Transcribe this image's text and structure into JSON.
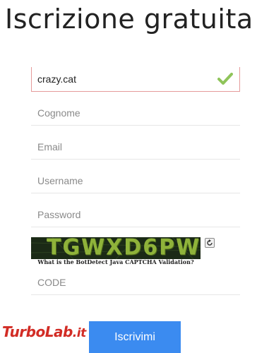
{
  "page": {
    "title": "Iscrizione gratuita"
  },
  "form": {
    "first_name": {
      "value": "crazy.cat",
      "placeholder": ""
    },
    "last_name": {
      "value": "",
      "placeholder": "Cognome"
    },
    "email": {
      "value": "",
      "placeholder": "Email"
    },
    "username": {
      "value": "",
      "placeholder": "Username"
    },
    "password": {
      "value": "",
      "placeholder": "Password"
    },
    "code": {
      "value": "",
      "placeholder": "CODE"
    },
    "submit_label": "Iscrivimi"
  },
  "captcha": {
    "code": "TGWXD6PW",
    "caption": "What is the BotDetect Java CAPTCHA Validation?"
  },
  "watermark": {
    "text": "TurboLab",
    "suffix": ".it"
  },
  "colors": {
    "accent": "#3b8bf0",
    "valid_check": "#8fc45a",
    "active_border": "#e59a9a",
    "watermark": "#d22c25"
  },
  "icons": {
    "valid": "check-icon",
    "refresh": "refresh-icon"
  }
}
